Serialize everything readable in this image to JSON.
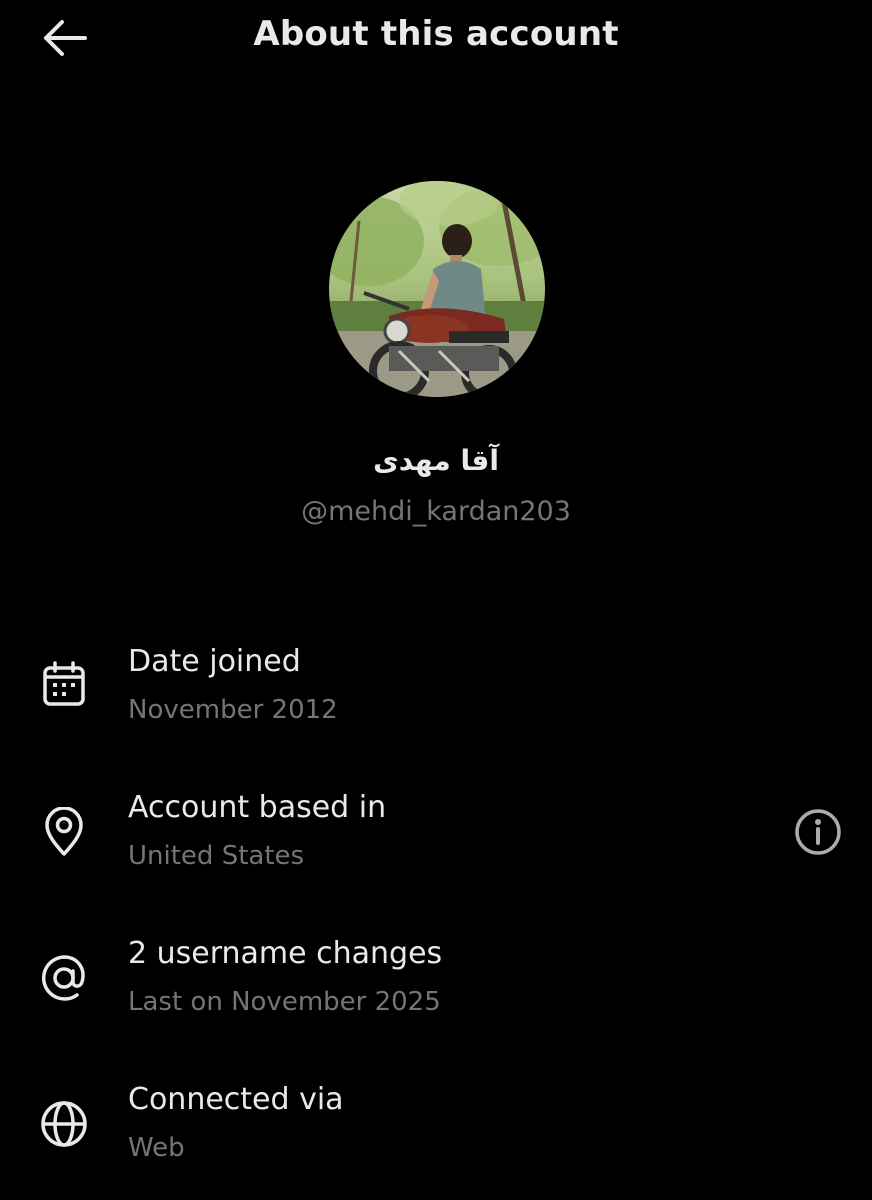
{
  "header": {
    "title": "About this account",
    "back_icon": "arrow-left-icon"
  },
  "profile": {
    "display_name": "آقا مهدی",
    "handle": "@mehdi_kardan203",
    "avatar_description_icon": "avatar-photo"
  },
  "rows": [
    {
      "icon": "calendar-icon",
      "title": "Date joined",
      "subtitle": "November 2012"
    },
    {
      "icon": "location-pin-icon",
      "title": "Account based in",
      "subtitle": "United States",
      "trailing_icon": "info-icon"
    },
    {
      "icon": "at-sign-icon",
      "title": "2 username changes",
      "subtitle": "Last on November 2025"
    },
    {
      "icon": "globe-icon",
      "title": "Connected via",
      "subtitle": "Web"
    }
  ],
  "colors": {
    "background": "#000000",
    "primary_text": "#e7e9ea",
    "secondary_text": "#71767b"
  }
}
